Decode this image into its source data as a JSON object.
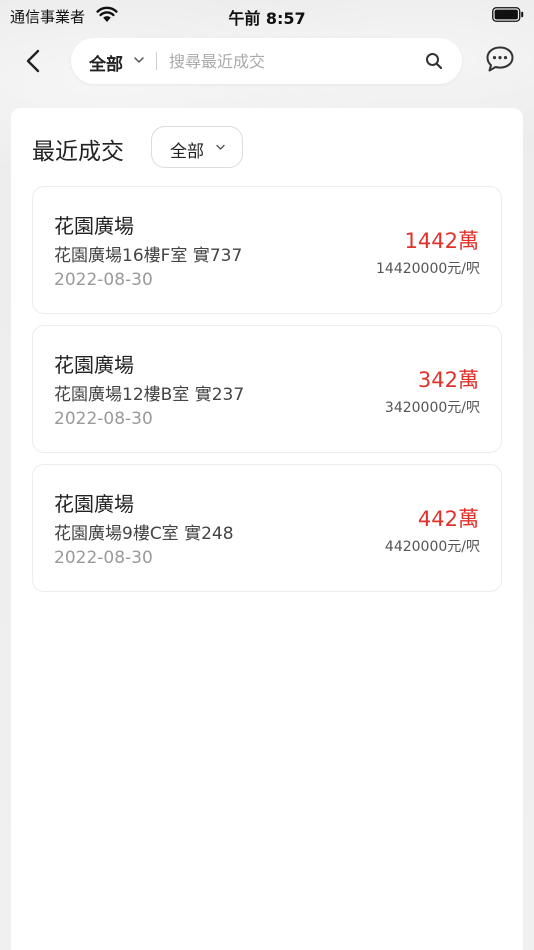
{
  "status_bar": {
    "carrier": "通信事業者",
    "time": "午前 8:57"
  },
  "search": {
    "scope_label": "全部",
    "placeholder": "搜尋最近成交",
    "value": ""
  },
  "panel": {
    "title": "最近成交",
    "filter_label": "全部"
  },
  "transactions": [
    {
      "name": "花園廣場",
      "unit": "花園廣場16樓F室 實737",
      "date": "2022-08-30",
      "price": "1442萬",
      "unit_price": "14420000元/呎"
    },
    {
      "name": "花園廣場",
      "unit": "花園廣場12樓B室 實237",
      "date": "2022-08-30",
      "price": "342萬",
      "unit_price": "3420000元/呎"
    },
    {
      "name": "花園廣場",
      "unit": "花園廣場9樓C室 實248",
      "date": "2022-08-30",
      "price": "442萬",
      "unit_price": "4420000元/呎"
    }
  ],
  "colors": {
    "price": "#e0312b",
    "background": "#eeeeee"
  }
}
